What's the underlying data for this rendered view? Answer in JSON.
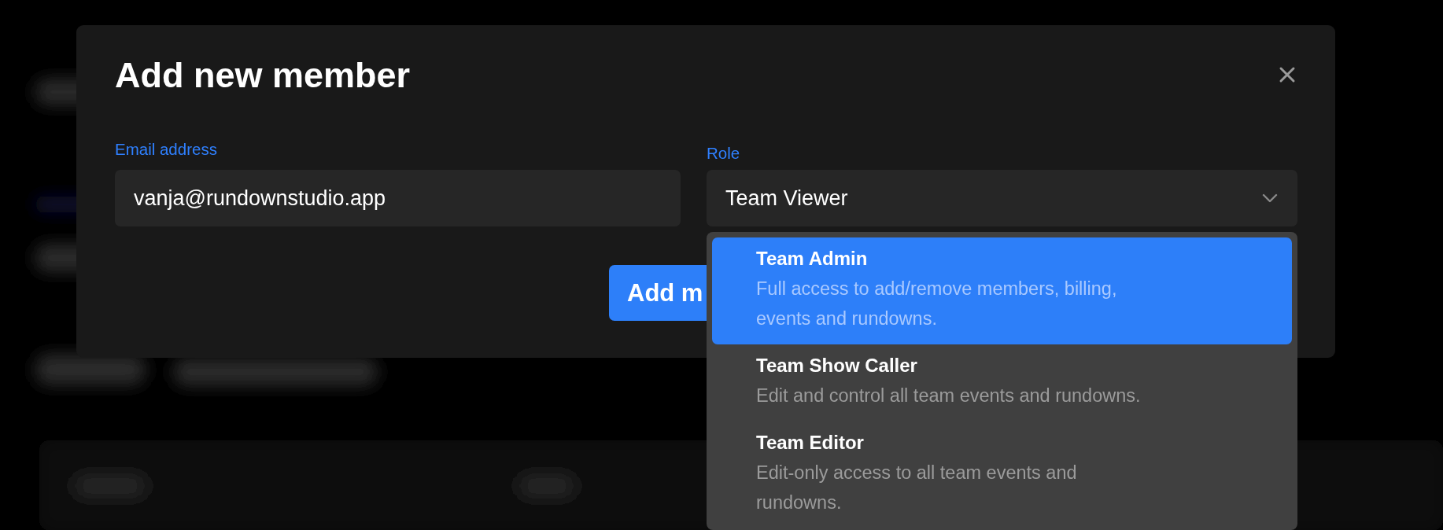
{
  "dialog": {
    "title": "Add new member",
    "fields": [
      {
        "kind": "text",
        "label": "Email address",
        "value": "vanja@rundownstudio.app"
      },
      {
        "kind": "select",
        "label": "Role",
        "value": "Team Viewer",
        "expanded": true
      }
    ],
    "submit_button": "Add m"
  },
  "role_menu": {
    "options": [
      {
        "name": "Team Admin",
        "description": "Full access to add/remove members, billing, events and rundowns.",
        "highlighted": true
      },
      {
        "name": "Team Show Caller",
        "description": "Edit and control all team events and rundowns.",
        "highlighted": false
      },
      {
        "name": "Team Editor",
        "description": "Edit-only access to all team events and rundowns.",
        "highlighted": false
      }
    ]
  }
}
